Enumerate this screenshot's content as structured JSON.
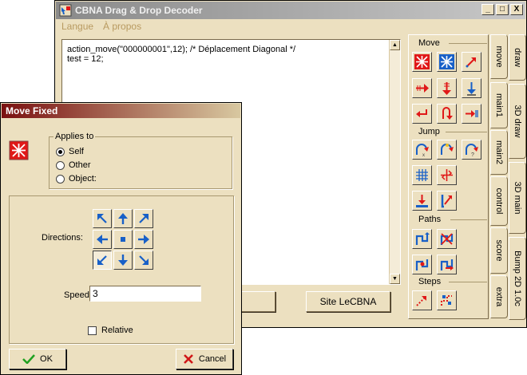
{
  "main_window": {
    "title": "CBNA Drag & Drop Decoder",
    "buttons": [
      "_",
      "□",
      "X"
    ],
    "menu": [
      "Langue",
      "À propos"
    ]
  },
  "code": {
    "lines": [
      "action_move(\"000000001\",12); /* Déplacement Diagonal */",
      "test = 12;"
    ]
  },
  "site_button": "Site LeCBNA",
  "palette": {
    "groups": [
      "Move",
      "Jump",
      "Paths",
      "Steps"
    ]
  },
  "tabs": {
    "inner": [
      "move",
      "main1",
      "main2",
      "control",
      "score",
      "extra"
    ],
    "outer": [
      "draw",
      "3D draw",
      "3D main",
      "Bump 2D 1.0c"
    ]
  },
  "dialog": {
    "title": "Move Fixed",
    "applies_to": {
      "label": "Applies to",
      "options": [
        "Self",
        "Other",
        "Object:"
      ],
      "selected": "Self"
    },
    "directions_label": "Directions:",
    "speed_label": "Speed:",
    "speed_value": "3",
    "relative_label": "Relative",
    "relative_checked": false,
    "ok_label": "OK",
    "cancel_label": "Cancel"
  },
  "colors": {
    "face": "#ece0c0",
    "dialog_title": "#7a1010",
    "icon_red": "#e01818",
    "icon_blue": "#1860c8"
  }
}
